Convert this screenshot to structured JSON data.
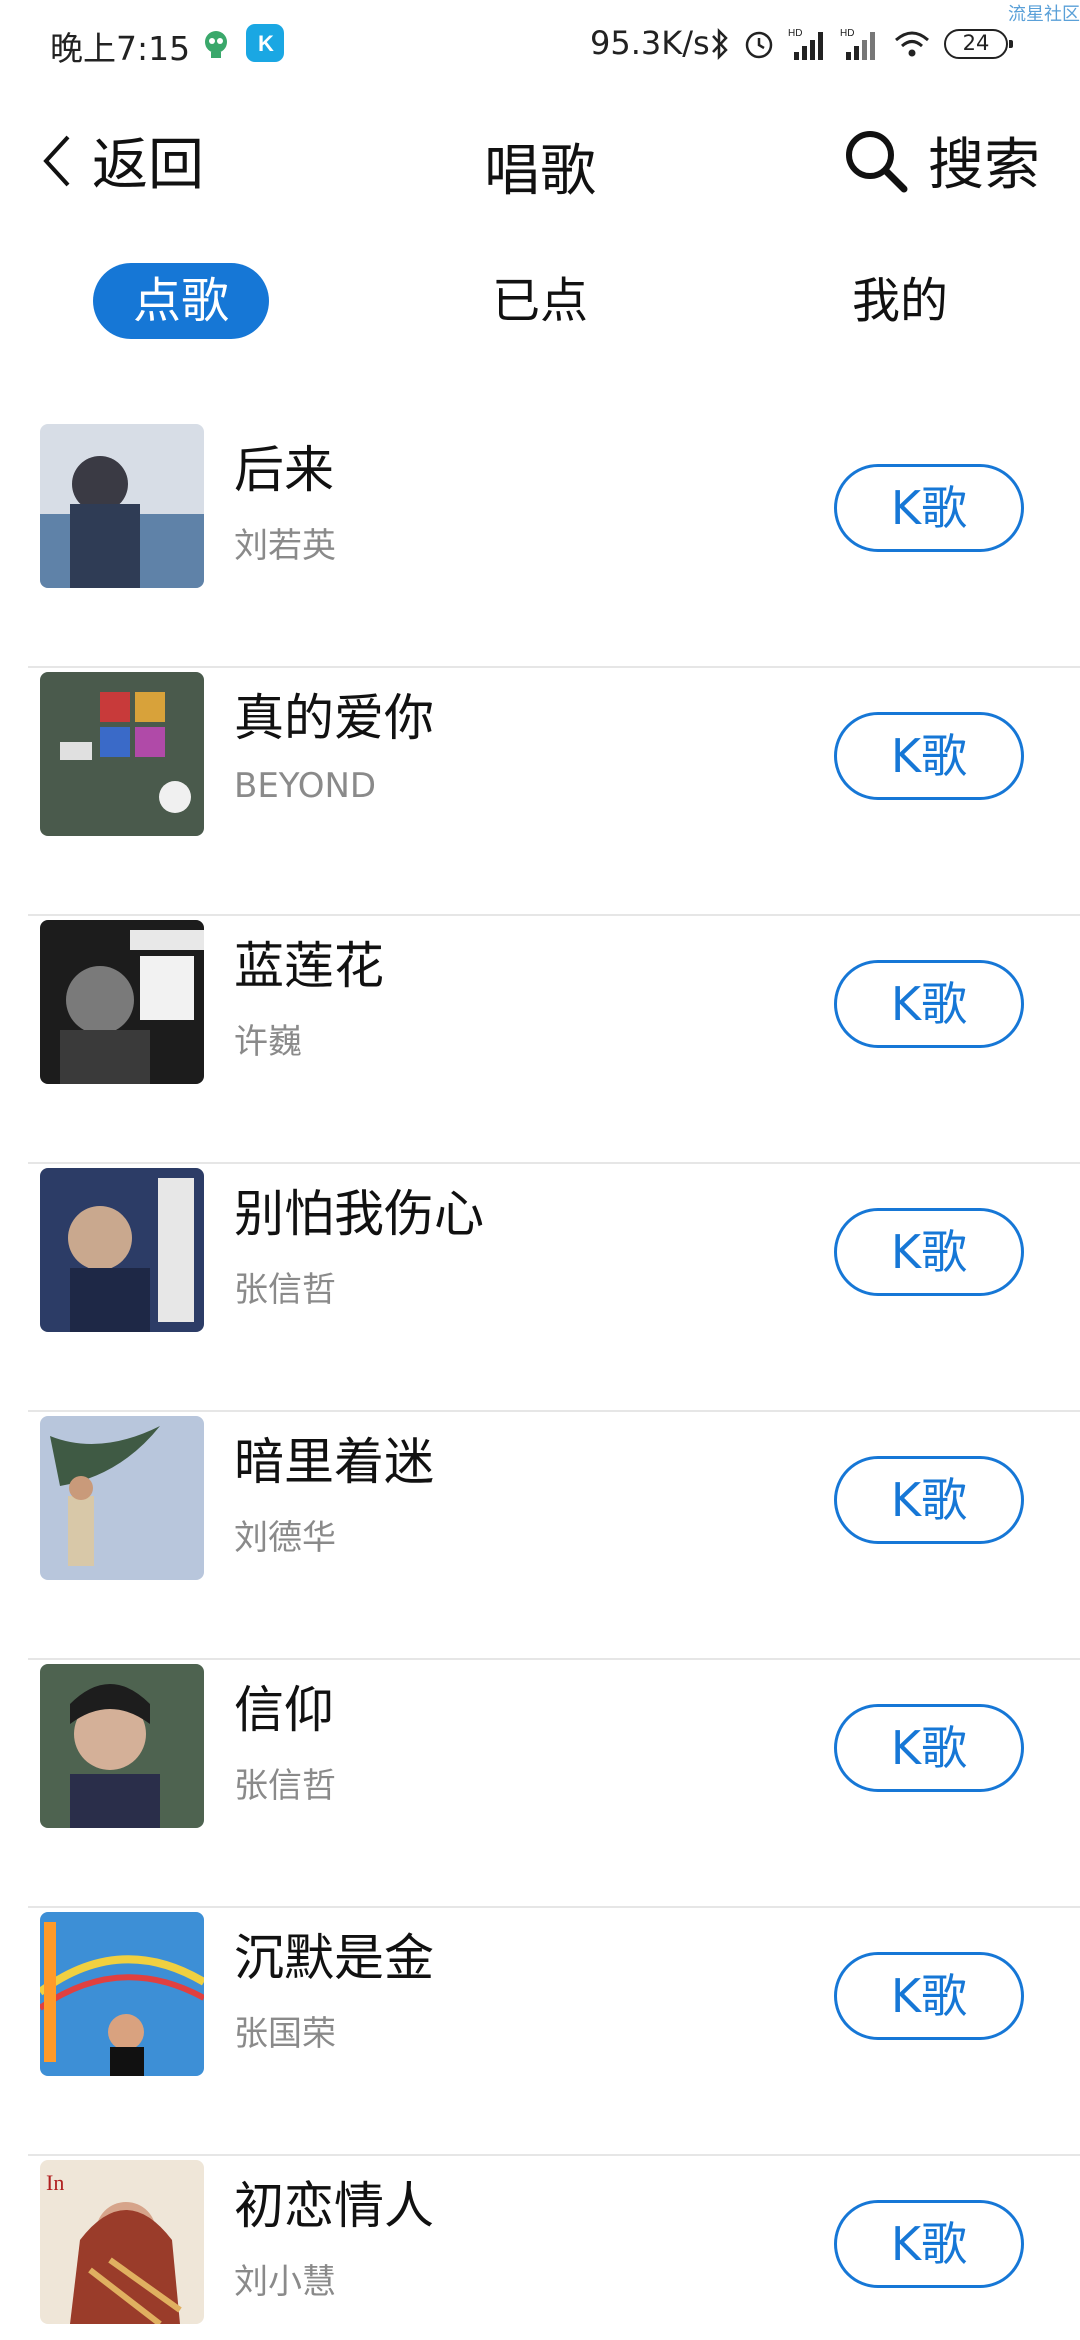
{
  "status_bar": {
    "time": "晚上7:15",
    "network_speed": "95.3K/s",
    "battery": "24",
    "watermark": "流星社区"
  },
  "header": {
    "back_label": "返回",
    "title": "唱歌",
    "search_label": "搜索"
  },
  "tabs": [
    {
      "label": "点歌",
      "active": true
    },
    {
      "label": "已点",
      "active": false
    },
    {
      "label": "我的",
      "active": false
    }
  ],
  "songs": [
    {
      "title": "后来",
      "artist": "刘若英",
      "button": "K歌",
      "cover_color": "#6f8fb0"
    },
    {
      "title": "真的爱你",
      "artist": "BEYOND",
      "button": "K歌",
      "cover_color": "#4b5a4a"
    },
    {
      "title": "蓝莲花",
      "artist": "许巍",
      "button": "K歌",
      "cover_color": "#2a2a2a"
    },
    {
      "title": "别怕我伤心",
      "artist": "张信哲",
      "button": "K歌",
      "cover_color": "#2e3f6a"
    },
    {
      "title": "暗里着迷",
      "artist": "刘德华",
      "button": "K歌",
      "cover_color": "#9db0cc"
    },
    {
      "title": "信仰",
      "artist": "张信哲",
      "button": "K歌",
      "cover_color": "#4a5d4e"
    },
    {
      "title": "沉默是金",
      "artist": "张国荣",
      "button": "K歌",
      "cover_color": "#3b86c9"
    },
    {
      "title": "初恋情人",
      "artist": "刘小慧",
      "button": "K歌",
      "cover_color": "#b5563a"
    }
  ],
  "colors": {
    "accent": "#1677d6",
    "secondary_text": "#8a8a8a",
    "divider": "#e6e6e6"
  }
}
